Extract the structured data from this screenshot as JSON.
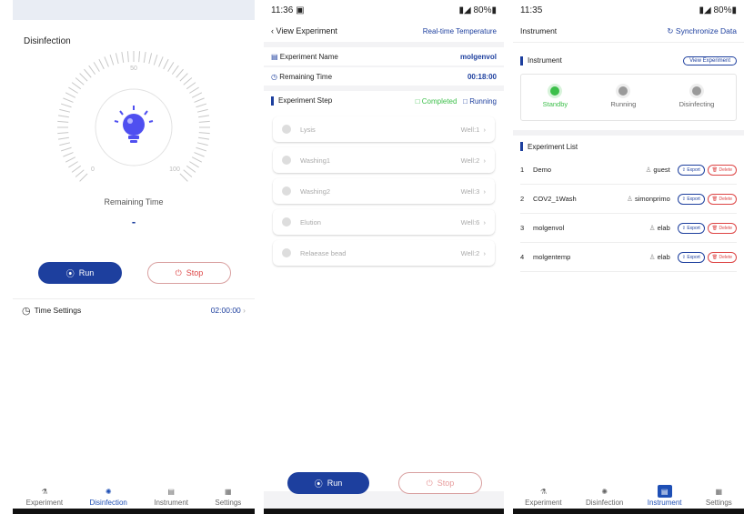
{
  "panel1": {
    "title": "Disinfection",
    "dial_top": "50",
    "dial_left": "0",
    "dial_right": "100",
    "remaining_label": "Remaining Time",
    "remaining_value": "-",
    "run_label": "Run",
    "stop_label": "Stop",
    "time_settings_label": "Time Settings",
    "time_settings_value": "02:00:00"
  },
  "panel2": {
    "status_time": "11:36",
    "battery": "80%",
    "back_label": "View Experiment",
    "realtime_label": "Real-time Temperature",
    "exp_name_label": "Experiment Name",
    "exp_name_value": "molgenvol",
    "remaining_label": "Remaining Time",
    "remaining_value": "00:18:00",
    "step_label": "Experiment Step",
    "legend_completed": "Completed",
    "legend_running": "Running",
    "steps": [
      {
        "name": "Lysis",
        "well": "Well:1"
      },
      {
        "name": "Washing1",
        "well": "Well:2"
      },
      {
        "name": "Washing2",
        "well": "Well:3"
      },
      {
        "name": "Elution",
        "well": "Well:6"
      },
      {
        "name": "Relaease bead",
        "well": "Well:2"
      }
    ],
    "run_label": "Run",
    "stop_label": "Stop"
  },
  "panel3": {
    "status_time": "11:35",
    "battery": "80%",
    "title": "Instrument",
    "sync_label": "Synchronize Data",
    "instrument_label": "Instrument",
    "view_exp_label": "View Experiment",
    "states": [
      {
        "label": "Standby",
        "color": "#3cbf4a"
      },
      {
        "label": "Running",
        "color": "#9a9a9a"
      },
      {
        "label": "Disinfecting",
        "color": "#9a9a9a"
      }
    ],
    "list_label": "Experiment List",
    "experiments": [
      {
        "index": "1",
        "name": "Demo",
        "user": "guest"
      },
      {
        "index": "2",
        "name": "COV2_1Wash",
        "user": "simonprimo"
      },
      {
        "index": "3",
        "name": "molgenvol",
        "user": "elab"
      },
      {
        "index": "4",
        "name": "molgentemp",
        "user": "elab"
      }
    ],
    "export_label": "Export",
    "delete_label": "Delete"
  },
  "tabs": [
    {
      "label": "Experiment",
      "icon": "flask-icon"
    },
    {
      "label": "Disinfection",
      "icon": "lamp-icon"
    },
    {
      "label": "Instrument",
      "icon": "instrument-icon"
    },
    {
      "label": "Settings",
      "icon": "grid-icon"
    }
  ],
  "colors": {
    "accent": "#1d3f9e",
    "standby": "#3cbf4a",
    "stop": "#dd4444",
    "tab_active": "#1e4fb5"
  }
}
